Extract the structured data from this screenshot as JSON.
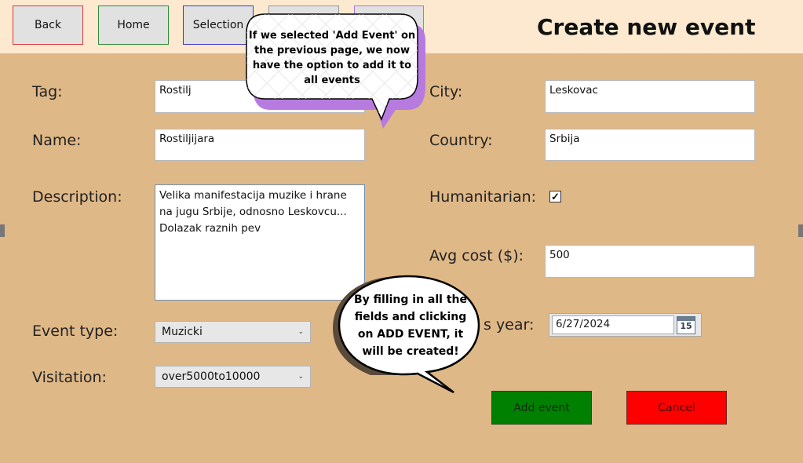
{
  "nav": {
    "back": "Back",
    "home": "Home",
    "selection": "Selection",
    "hidden_button_4": "",
    "hidden_button_5": ""
  },
  "page_title": "Create new event",
  "form": {
    "tag": {
      "label": "Tag:",
      "value": "Rostilj"
    },
    "name": {
      "label": "Name:",
      "value": "Rostiljijara"
    },
    "description": {
      "label": "Description:",
      "value": "Velika manifestacija muzike i hrane na jugu Srbije, odnosno Leskovcu...\nDolazak raznih pev"
    },
    "event_type": {
      "label": "Event type:",
      "value": "Muzicki"
    },
    "visitation": {
      "label": "Visitation:",
      "value": "over5000to10000"
    },
    "city": {
      "label": "City:",
      "value": "Leskovac"
    },
    "country": {
      "label": "Country:",
      "value": "Srbija"
    },
    "humanitarian": {
      "label": "Humanitarian:",
      "checked": true
    },
    "avg_cost": {
      "label": "Avg cost ($):",
      "value": "500"
    },
    "date": {
      "label_visible": "s year:",
      "value": "6/27/2024",
      "calendar_day": "15"
    }
  },
  "actions": {
    "add": "Add event",
    "cancel": "Cancel"
  },
  "tooltips": {
    "top_lines": [
      "If we selected 'Add Event' on",
      "the previous page, we now",
      "have the option to add it to",
      "all events"
    ],
    "bottom_lines": [
      "By filling in all the",
      "fields and clicking",
      "on ADD EVENT, it",
      "will be created!"
    ]
  },
  "colors": {
    "header_bg": "#fde9cf",
    "page_bg": "#dfb887",
    "back_border": "#d33b3b",
    "home_border": "#2f8a3a",
    "selection_border": "#3b3bc8",
    "add_bg": "#008000",
    "cancel_bg": "#ff0000",
    "bubble_shadow_top": "#b77be0",
    "bubble_shadow_bottom": "#5a4a3a"
  }
}
